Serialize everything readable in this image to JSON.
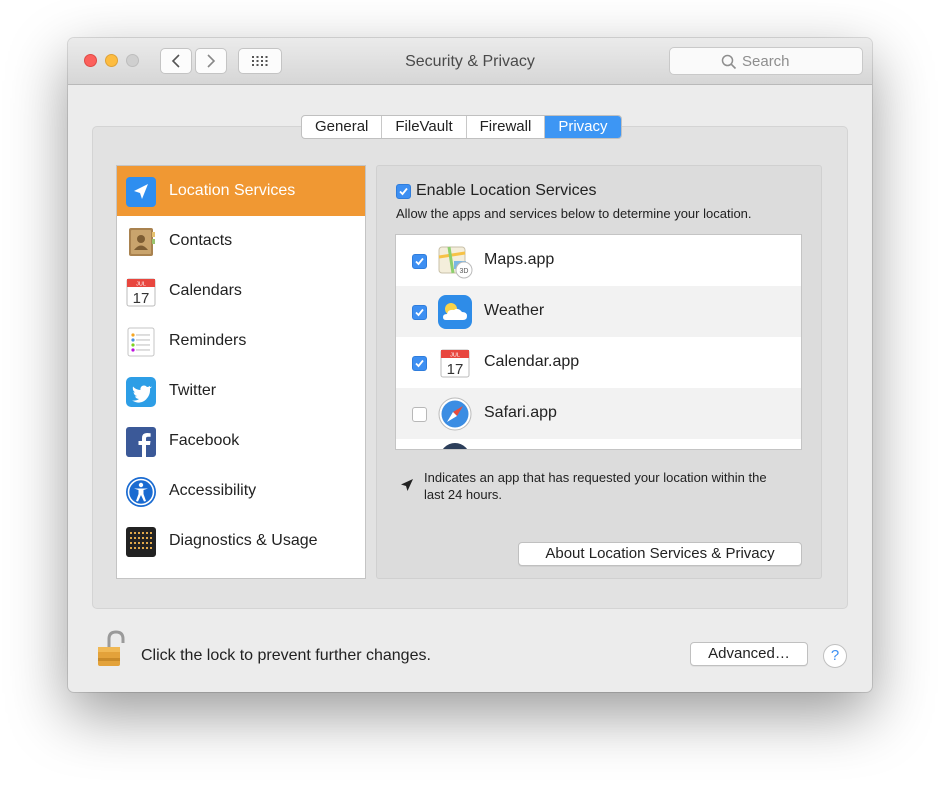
{
  "window": {
    "title": "Security & Privacy",
    "search_placeholder": "Search"
  },
  "tabs": [
    {
      "label": "General",
      "selected": false
    },
    {
      "label": "FileVault",
      "selected": false
    },
    {
      "label": "Firewall",
      "selected": false
    },
    {
      "label": "Privacy",
      "selected": true
    }
  ],
  "sidebar": {
    "items": [
      {
        "label": "Location Services",
        "icon": "location-arrow-icon",
        "selected": true
      },
      {
        "label": "Contacts",
        "icon": "contacts-icon",
        "selected": false
      },
      {
        "label": "Calendars",
        "icon": "calendar-icon",
        "selected": false
      },
      {
        "label": "Reminders",
        "icon": "reminders-icon",
        "selected": false
      },
      {
        "label": "Twitter",
        "icon": "twitter-icon",
        "selected": false
      },
      {
        "label": "Facebook",
        "icon": "facebook-icon",
        "selected": false
      },
      {
        "label": "Accessibility",
        "icon": "accessibility-icon",
        "selected": false
      },
      {
        "label": "Diagnostics & Usage",
        "icon": "diagnostics-icon",
        "selected": false
      }
    ]
  },
  "location": {
    "enable_label": "Enable Location Services",
    "enabled": true,
    "description": "Allow the apps and services below to determine your location.",
    "apps": [
      {
        "name": "Maps.app",
        "checked": true,
        "icon": "maps-icon"
      },
      {
        "name": "Weather",
        "checked": true,
        "icon": "weather-icon"
      },
      {
        "name": "Calendar.app",
        "checked": true,
        "icon": "calendar-icon"
      },
      {
        "name": "Safari.app",
        "checked": false,
        "icon": "safari-icon"
      }
    ],
    "note_line1": "Indicates an app that has requested your location within the",
    "note_line2": "last 24 hours.",
    "about_button": "About Location Services & Privacy"
  },
  "footer": {
    "lock_text": "Click the lock to prevent further changes.",
    "advanced_button": "Advanced…",
    "help_label": "?"
  },
  "colors": {
    "selection_orange": "#f09833",
    "accent_blue": "#3d96f4"
  },
  "calendar_icon": {
    "month": "JUL",
    "day": "17"
  }
}
